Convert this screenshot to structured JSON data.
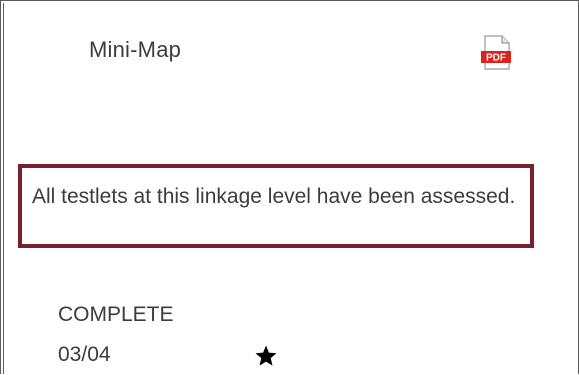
{
  "header": {
    "title": "Mini-Map",
    "pdf_icon": "pdf-file-icon",
    "pdf_icon_text": "PDF",
    "pdf_icon_color": "#d9231c"
  },
  "status": {
    "message": "All testlets at this linkage level have been assessed.",
    "border_color": "#7a1f2b"
  },
  "progress": {
    "label": "COMPLETE",
    "score": "03/04",
    "icon": "star-icon"
  }
}
